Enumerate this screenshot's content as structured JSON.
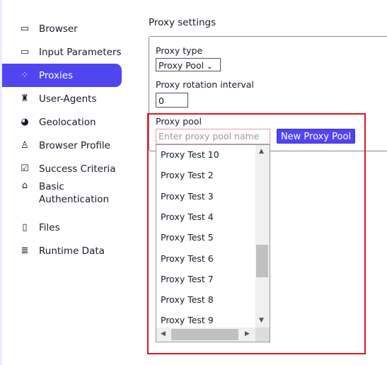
{
  "sidebar": {
    "items": [
      {
        "label": "Browser",
        "icon": "browser-window-icon",
        "glyph": "▭"
      },
      {
        "label": "Input Parameters",
        "icon": "input-field-icon",
        "glyph": "▭"
      },
      {
        "label": "Proxies",
        "icon": "network-nodes-icon",
        "glyph": "⁘"
      },
      {
        "label": "User-Agents",
        "icon": "user-agent-icon",
        "glyph": "♜"
      },
      {
        "label": "Geolocation",
        "icon": "globe-icon",
        "glyph": "◕"
      },
      {
        "label": "Browser Profile",
        "icon": "user-profile-icon",
        "glyph": "♙"
      },
      {
        "label": "Success Criteria",
        "icon": "clipboard-check-icon",
        "glyph": "☑"
      },
      {
        "label": "Basic Authentication",
        "icon": "unlock-icon",
        "glyph": "⌂"
      },
      {
        "label": "Files",
        "icon": "file-icon",
        "glyph": "▯"
      },
      {
        "label": "Runtime Data",
        "icon": "database-icon",
        "glyph": "≣"
      }
    ],
    "active": "Proxies",
    "accent": "#5046f0"
  },
  "main": {
    "title": "Proxy settings",
    "proxy_type_label": "Proxy type",
    "proxy_type_value": "Proxy Pool",
    "rotation_label": "Proxy rotation interval",
    "rotation_value": "0",
    "pool_label": "Proxy pool",
    "pool_placeholder": "Enter proxy pool name",
    "new_pool_button": "New Proxy Pool",
    "pool_options": [
      "Proxy Test 10",
      "Proxy Test 2",
      "Proxy Test 3",
      "Proxy Test 4",
      "Proxy Test 5",
      "Proxy Test 6",
      "Proxy Test 7",
      "Proxy Test 8",
      "Proxy Test 9"
    ],
    "highlight_color": "#e8141e"
  }
}
